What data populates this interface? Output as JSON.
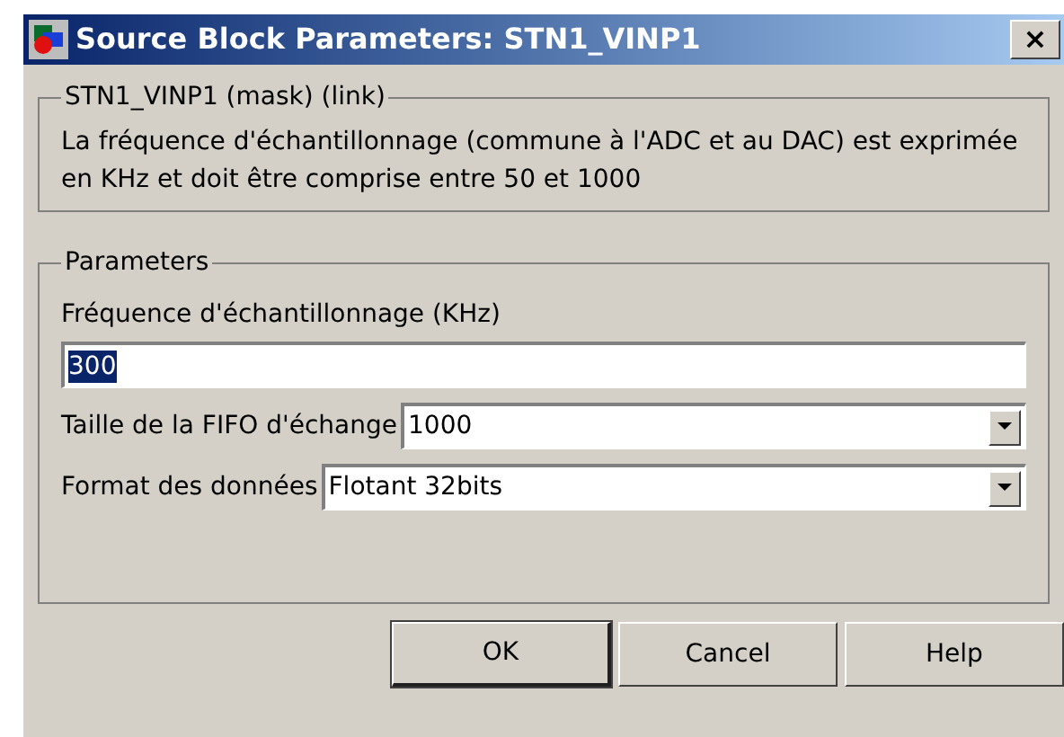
{
  "window": {
    "title": "Source Block Parameters: STN1_VINP1",
    "close": "×"
  },
  "description_group": {
    "title": "STN1_VINP1 (mask) (link)",
    "text": "La fréquence d'échantillonnage (commune à l'ADC et au DAC) est exprimée en KHz et doit être comprise entre 50 et 1000"
  },
  "parameters_group": {
    "title": "Parameters",
    "fields": [
      {
        "kind": "text",
        "label": "Fréquence d'échantillonnage (KHz)",
        "value": "300",
        "text_selected": true
      },
      {
        "kind": "dropdown",
        "label": "Taille de la FIFO d'échange",
        "value": "1000"
      },
      {
        "kind": "dropdown",
        "label": "Format des données",
        "value": "Flotant 32bits"
      }
    ]
  },
  "buttons": [
    {
      "label": "OK",
      "default": true
    },
    {
      "label": "Cancel",
      "default": false
    },
    {
      "label": "Help",
      "default": false
    }
  ]
}
